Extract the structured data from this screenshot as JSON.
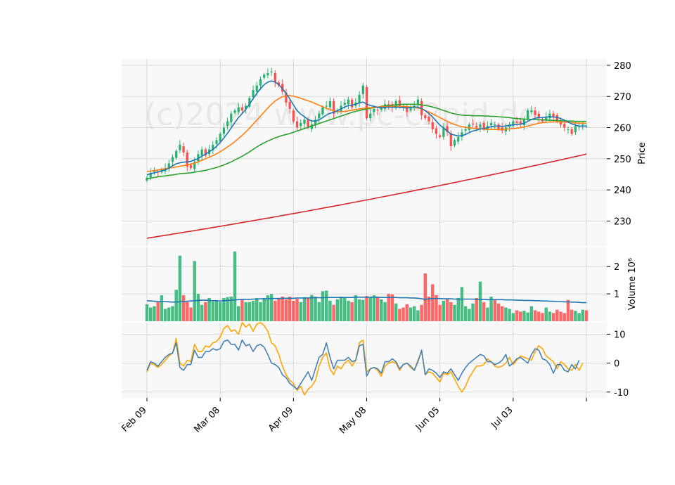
{
  "chart_data": {
    "type": "candlestick",
    "watermark": "(c)2024 www.pc-c2pid.de",
    "colors": {
      "up": "#26b36e",
      "down": "#ff4d4d",
      "panel_bg": "#f8f8f8",
      "grid": "#d9d9d9",
      "ma_fast": "#1f77b4",
      "ma_mid": "#ff7f0e",
      "ma_slow": "#2ca02c",
      "ma_long": "#d62728",
      "vol_ma": "#1f77b4",
      "osc_a": "#4682b4",
      "osc_b": "#ffa500"
    },
    "x": {
      "n_bars": 121,
      "tick_labels": [
        "Feb 09",
        "Mar 08",
        "Apr 09",
        "May 08",
        "Jun 05",
        "Jul 03"
      ],
      "tick_index": [
        0,
        20,
        40,
        60,
        80,
        100,
        120
      ]
    },
    "price_panel": {
      "ylabel": "Price",
      "ylim": [
        222,
        282
      ],
      "ticks": [
        230,
        240,
        250,
        260,
        270,
        280
      ],
      "closes": [
        244,
        245.5,
        246,
        245.5,
        246.5,
        247,
        248.5,
        250.5,
        252.5,
        254.5,
        252,
        247.5,
        247,
        249,
        251.5,
        253,
        251,
        253,
        254.5,
        256,
        258,
        260,
        262,
        264.5,
        265.5,
        266.5,
        265.5,
        267,
        269.5,
        272,
        273.5,
        275.5,
        277,
        277.5,
        278,
        274.5,
        273.5,
        271.5,
        268,
        266,
        262,
        260,
        261.5,
        262.5,
        260,
        261,
        262.5,
        264.5,
        266.5,
        267,
        268.5,
        264.5,
        265.5,
        267,
        268,
        269,
        266.5,
        268,
        270.5,
        273.5,
        263,
        264.5,
        266,
        265.5,
        266.5,
        267.5,
        267,
        266.5,
        268.5,
        267,
        266.5,
        265,
        266.5,
        267,
        269,
        264,
        263,
        262,
        259.5,
        258,
        257,
        260,
        258.5,
        254,
        256,
        257,
        258.5,
        259.5,
        261,
        261,
        260,
        261,
        259.5,
        260.5,
        261.5,
        261,
        259.5,
        259,
        260,
        261,
        262,
        261.5,
        261,
        262.5,
        265.5,
        265.5,
        264,
        263,
        262,
        263.5,
        264.5,
        263.5,
        262,
        261,
        260,
        259.5,
        258,
        260.5,
        260.5,
        261,
        260.5
      ],
      "ma_fast": [
        244.8,
        245.2,
        245.5,
        245.8,
        246.1,
        246.4,
        247,
        247.8,
        248.4,
        248.7,
        248.9,
        249,
        249.2,
        249.6,
        250.1,
        250.8,
        251.5,
        252.2,
        253,
        254,
        255.2,
        256.7,
        258.2,
        259.9,
        261.6,
        263.2,
        264.5,
        265.9,
        267.5,
        269.3,
        271,
        272.5,
        273.8,
        274.6,
        275,
        274.6,
        273.8,
        272.5,
        271,
        269.2,
        267.3,
        265.5,
        264.3,
        263.5,
        262.6,
        262.1,
        262.1,
        262.5,
        263.2,
        264,
        264.6,
        264.9,
        265.4,
        266,
        266.6,
        267.1,
        267.2,
        267.5,
        267.9,
        268.2,
        267.6,
        267.1,
        266.8,
        266.5,
        266.4,
        266.5,
        266.6,
        266.5,
        266.6,
        266.5,
        266.4,
        266.3,
        266.5,
        266.6,
        266.6,
        266.1,
        265.4,
        264.5,
        263.4,
        262.1,
        260.8,
        259.9,
        258.9,
        257.9,
        257.6,
        257.3,
        257.4,
        257.8,
        258.4,
        258.9,
        259.2,
        259.6,
        259.7,
        260,
        260.3,
        260.5,
        260.5,
        260.4,
        260.5,
        260.7,
        260.9,
        261,
        261.1,
        261.4,
        262,
        262.6,
        263,
        263.2,
        263.2,
        263.4,
        263.5,
        263.4,
        263.3,
        262.9,
        262.4,
        261.8,
        261.2,
        260.8,
        260.5,
        260.5,
        260.5
      ],
      "ma_mid": [
        245.9,
        246,
        246.2,
        246.4,
        246.6,
        246.8,
        247,
        247.2,
        247.4,
        247.6,
        247.8,
        248,
        248.3,
        248.6,
        249,
        249.5,
        250,
        250.5,
        251,
        251.6,
        252.3,
        253,
        253.8,
        254.6,
        255.5,
        256.5,
        257.5,
        258.6,
        259.8,
        261.1,
        262.4,
        263.7,
        265,
        266.3,
        267.5,
        268.5,
        269.3,
        269.9,
        270.2,
        270.3,
        270.1,
        269.8,
        269.4,
        269,
        268.6,
        268.2,
        267.7,
        267.2,
        266.7,
        266.2,
        265.8,
        265.4,
        265.2,
        265.1,
        265.2,
        265.4,
        265.6,
        265.8,
        266,
        266.2,
        266.3,
        266.4,
        266.5,
        266.6,
        266.7,
        266.7,
        266.8,
        266.8,
        266.8,
        266.8,
        266.8,
        266.7,
        266.6,
        266.5,
        266.3,
        266,
        265.5,
        265,
        264.4,
        263.8,
        263.2,
        262.6,
        262,
        261.5,
        261,
        260.6,
        260.3,
        260.1,
        259.9,
        259.8,
        259.7,
        259.6,
        259.5,
        259.4,
        259.4,
        259.4,
        259.4,
        259.4,
        259.5,
        259.6,
        259.7,
        259.8,
        260,
        260.2,
        260.5,
        260.8,
        261.1,
        261.4,
        261.6,
        261.7,
        261.8,
        261.8,
        261.8,
        261.8,
        261.8,
        261.7,
        261.6,
        261.5,
        261.4,
        261.4,
        261.4
      ],
      "ma_slow": [
        243.6,
        243.8,
        244,
        244.2,
        244.4,
        244.5,
        244.7,
        244.8,
        245,
        245.2,
        245.3,
        245.4,
        245.5,
        245.7,
        245.9,
        246.1,
        246.3,
        246.6,
        246.9,
        247.2,
        247.6,
        248,
        248.5,
        249,
        249.6,
        250.2,
        250.8,
        251.5,
        252.2,
        253,
        253.8,
        254.5,
        255.1,
        255.7,
        256.2,
        256.7,
        257.1,
        257.5,
        257.8,
        258.1,
        258.5,
        258.9,
        259.3,
        259.7,
        260.1,
        260.5,
        260.9,
        261.3,
        261.7,
        262.1,
        262.5,
        262.9,
        263.3,
        263.7,
        264.1,
        264.5,
        264.9,
        265.2,
        265.5,
        265.8,
        266,
        266.2,
        266.4,
        266.6,
        266.8,
        267,
        267.1,
        267.2,
        267.3,
        267.4,
        267.5,
        267.5,
        267.5,
        267.5,
        267.4,
        267.3,
        267.1,
        266.9,
        266.6,
        266.3,
        265.9,
        265.5,
        265.1,
        264.7,
        264.4,
        264.2,
        264,
        263.9,
        263.9,
        263.8,
        263.8,
        263.8,
        263.7,
        263.7,
        263.6,
        263.6,
        263.5,
        263.4,
        263.3,
        263.2,
        263,
        262.9,
        262.8,
        262.7,
        262.7,
        262.6,
        262.6,
        262.5,
        262.5,
        262.4,
        262.4,
        262.3,
        262.3,
        262.2,
        262.2,
        262.1,
        262.1,
        262,
        262,
        262,
        262
      ],
      "ma_long_range": [
        224.5,
        251.5
      ]
    },
    "volume_panel": {
      "ylabel": "Volume  10⁶",
      "ylim": [
        0,
        2.7
      ],
      "ticks": [
        1,
        2
      ],
      "volumes": [
        0.62,
        0.5,
        0.55,
        0.7,
        0.95,
        0.45,
        0.5,
        0.55,
        1.15,
        2.4,
        0.95,
        0.7,
        0.5,
        2.2,
        1.0,
        0.6,
        0.7,
        0.85,
        0.72,
        0.75,
        0.7,
        0.85,
        0.88,
        0.9,
        2.55,
        0.55,
        0.8,
        0.7,
        0.7,
        0.75,
        0.85,
        0.7,
        0.85,
        0.95,
        1.0,
        0.75,
        0.85,
        0.9,
        0.8,
        0.9,
        0.75,
        0.82,
        0.7,
        0.88,
        0.85,
        0.96,
        0.9,
        0.7,
        1.1,
        1.12,
        0.75,
        0.6,
        0.8,
        0.9,
        0.85,
        0.75,
        0.7,
        0.95,
        0.8,
        0.78,
        0.92,
        0.88,
        0.95,
        0.9,
        0.8,
        0.7,
        1.0,
        0.98,
        0.65,
        0.45,
        0.5,
        0.62,
        0.5,
        0.55,
        0.4,
        0.6,
        1.75,
        0.9,
        1.35,
        0.95,
        0.6,
        0.75,
        0.8,
        0.7,
        0.6,
        0.85,
        1.25,
        0.55,
        0.45,
        0.65,
        0.85,
        1.45,
        0.7,
        0.5,
        0.9,
        0.78,
        0.65,
        0.55,
        0.5,
        0.45,
        0.3,
        0.4,
        0.35,
        0.38,
        0.32,
        0.55,
        0.4,
        0.35,
        0.3,
        0.5,
        0.35,
        0.3,
        0.42,
        0.35,
        0.3,
        0.78,
        0.42,
        0.38,
        0.3,
        0.42,
        0.4
      ],
      "vol_ma": [
        0.75,
        0.74,
        0.73,
        0.72,
        0.72,
        0.72,
        0.71,
        0.7,
        0.71,
        0.71,
        0.72,
        0.73,
        0.74,
        0.75,
        0.76,
        0.77,
        0.77,
        0.76,
        0.75,
        0.75,
        0.74,
        0.75,
        0.76,
        0.77,
        0.78,
        0.79,
        0.8,
        0.8,
        0.8,
        0.81,
        0.81,
        0.82,
        0.82,
        0.82,
        0.83,
        0.83,
        0.83,
        0.84,
        0.84,
        0.84,
        0.84,
        0.85,
        0.85,
        0.85,
        0.85,
        0.86,
        0.86,
        0.86,
        0.86,
        0.87,
        0.87,
        0.87,
        0.87,
        0.87,
        0.87,
        0.87,
        0.87,
        0.88,
        0.88,
        0.88,
        0.88,
        0.88,
        0.88,
        0.88,
        0.87,
        0.87,
        0.87,
        0.87,
        0.87,
        0.86,
        0.86,
        0.86,
        0.85,
        0.85,
        0.84,
        0.82,
        0.8,
        0.82,
        0.83,
        0.83,
        0.83,
        0.82,
        0.82,
        0.82,
        0.81,
        0.81,
        0.81,
        0.81,
        0.81,
        0.81,
        0.8,
        0.8,
        0.8,
        0.79,
        0.79,
        0.79,
        0.79,
        0.79,
        0.78,
        0.78,
        0.78,
        0.77,
        0.77,
        0.76,
        0.76,
        0.76,
        0.75,
        0.75,
        0.74,
        0.74,
        0.73,
        0.73,
        0.72,
        0.72,
        0.71,
        0.71,
        0.7,
        0.7,
        0.69,
        0.68,
        0.68
      ]
    },
    "osc_panel": {
      "ylim": [
        -12,
        14
      ],
      "ticks": [
        -10,
        0,
        10
      ],
      "series_a": [
        -2.5,
        0.5,
        0,
        -1,
        0.5,
        2,
        3,
        3.5,
        7,
        -1.5,
        -2.5,
        -0.5,
        -0.5,
        4.5,
        2,
        2,
        4,
        4,
        5,
        4.5,
        5,
        7.5,
        8,
        6.5,
        6.5,
        4.5,
        8,
        6,
        6.5,
        4,
        6,
        6.5,
        5.5,
        3,
        0,
        -0.5,
        -1.5,
        -4,
        -5,
        -7,
        -8,
        -9,
        -7,
        -5,
        -3,
        -6,
        -2,
        2,
        3,
        7,
        2,
        -2,
        1,
        1,
        1,
        2,
        0.5,
        1,
        6,
        6.5,
        -4.5,
        -2,
        -1.5,
        -2,
        -3.5,
        0.5,
        0.5,
        1.5,
        0.5,
        -2,
        -0.5,
        0,
        -1,
        -2.5,
        0.5,
        4.5,
        -4,
        -2,
        -2.5,
        -3.5,
        -5,
        -3,
        -3.5,
        -2,
        -4,
        -6,
        -3.5,
        -1.5,
        0,
        1,
        2,
        3,
        2.5,
        0.5,
        0.5,
        -0.5,
        0,
        1,
        3,
        -1,
        0,
        1.5,
        2,
        1,
        0,
        3,
        5,
        4.5,
        1.5,
        1,
        -0.5,
        -3.5,
        -0.5,
        -0.5,
        -2.5,
        -3,
        -0.5,
        -2,
        1
      ],
      "series_b": [
        -3,
        0,
        -0.5,
        -1.5,
        -0.5,
        1,
        2.5,
        3.5,
        8.5,
        0,
        -1,
        1,
        0.5,
        6.5,
        4,
        4,
        6,
        5.5,
        7,
        7.5,
        9,
        12,
        13,
        11,
        11.5,
        10,
        14,
        12.5,
        13.5,
        11,
        13.5,
        14,
        13,
        11,
        7,
        6,
        3,
        -1,
        -4,
        -6,
        -7,
        -9.5,
        -8,
        -11,
        -9,
        -8,
        -6,
        -1,
        2,
        3.5,
        -2,
        -4,
        -1,
        -2,
        0,
        1,
        -1,
        1,
        7,
        8,
        -3,
        -2,
        -1.5,
        -2.5,
        -4.5,
        -1,
        0,
        0.5,
        0,
        -2.5,
        -0.5,
        0,
        -1.5,
        -2.5,
        1,
        4,
        -4,
        -3,
        -3.5,
        -5,
        -6.5,
        -3.5,
        -4,
        -3,
        -5.5,
        -8,
        -10,
        -8,
        -5,
        -3,
        -1,
        -1,
        -0.5,
        1.5,
        0.5,
        -1,
        -1.5,
        -1,
        0,
        2,
        -0.5,
        1,
        2.5,
        2,
        1.5,
        1,
        4,
        6,
        5,
        2.5,
        1.5,
        0.5,
        -2,
        0.5,
        -0.5,
        -2,
        -2.5,
        -0.5,
        -2.5,
        0
      ]
    }
  }
}
